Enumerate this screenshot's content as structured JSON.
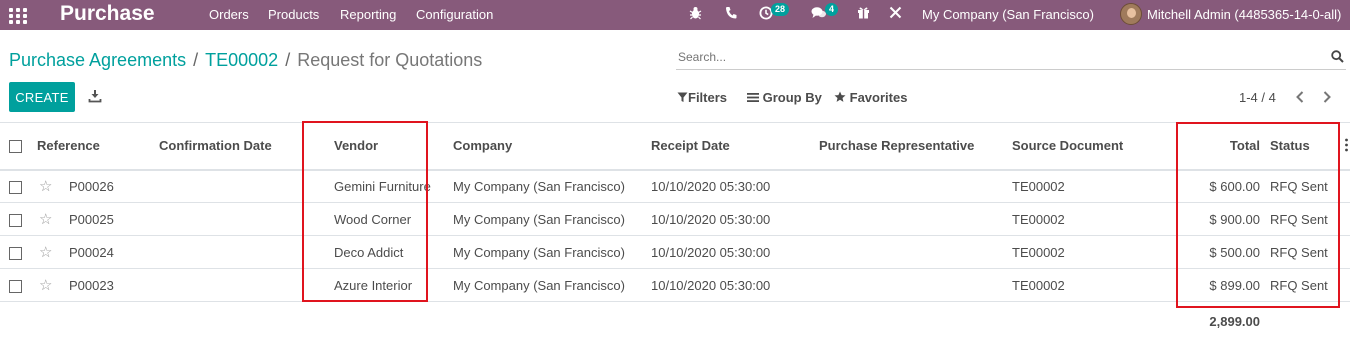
{
  "topbar": {
    "app_title": "Purchase",
    "menu": [
      "Orders",
      "Products",
      "Reporting",
      "Configuration"
    ],
    "activity_count": "28",
    "messages_count": "4",
    "company": "My Company (San Francisco)",
    "user": "Mitchell Admin (4485365-14-0-all)",
    "colors": {
      "bar": "#875a7b",
      "badge": "#00a09d"
    }
  },
  "breadcrumb": {
    "items": [
      "Purchase Agreements",
      "TE00002"
    ],
    "current": "Request for Quotations"
  },
  "search": {
    "placeholder": "Search..."
  },
  "toolbar": {
    "create_label": "CREATE",
    "filters_label": "Filters",
    "groupby_label": "Group By",
    "favorites_label": "Favorites",
    "pager": "1-4 / 4"
  },
  "table": {
    "columns": [
      "Reference",
      "Confirmation Date",
      "Vendor",
      "Company",
      "Receipt Date",
      "Purchase Representative",
      "Source Document",
      "Total",
      "Status"
    ],
    "rows": [
      {
        "reference": "P00026",
        "confirmation_date": "",
        "vendor": "Gemini Furniture",
        "company": "My Company (San Francisco)",
        "receipt_date": "10/10/2020 05:30:00",
        "representative": "",
        "source": "TE00002",
        "total": "$ 600.00",
        "status": "RFQ Sent"
      },
      {
        "reference": "P00025",
        "confirmation_date": "",
        "vendor": "Wood Corner",
        "company": "My Company (San Francisco)",
        "receipt_date": "10/10/2020 05:30:00",
        "representative": "",
        "source": "TE00002",
        "total": "$ 900.00",
        "status": "RFQ Sent"
      },
      {
        "reference": "P00024",
        "confirmation_date": "",
        "vendor": "Deco Addict",
        "company": "My Company (San Francisco)",
        "receipt_date": "10/10/2020 05:30:00",
        "representative": "",
        "source": "TE00002",
        "total": "$ 500.00",
        "status": "RFQ Sent"
      },
      {
        "reference": "P00023",
        "confirmation_date": "",
        "vendor": "Azure Interior",
        "company": "My Company (San Francisco)",
        "receipt_date": "10/10/2020 05:30:00",
        "representative": "",
        "source": "TE00002",
        "total": "$ 899.00",
        "status": "RFQ Sent"
      }
    ],
    "sum_total": "2,899.00"
  },
  "highlight_color": "#e0141e"
}
